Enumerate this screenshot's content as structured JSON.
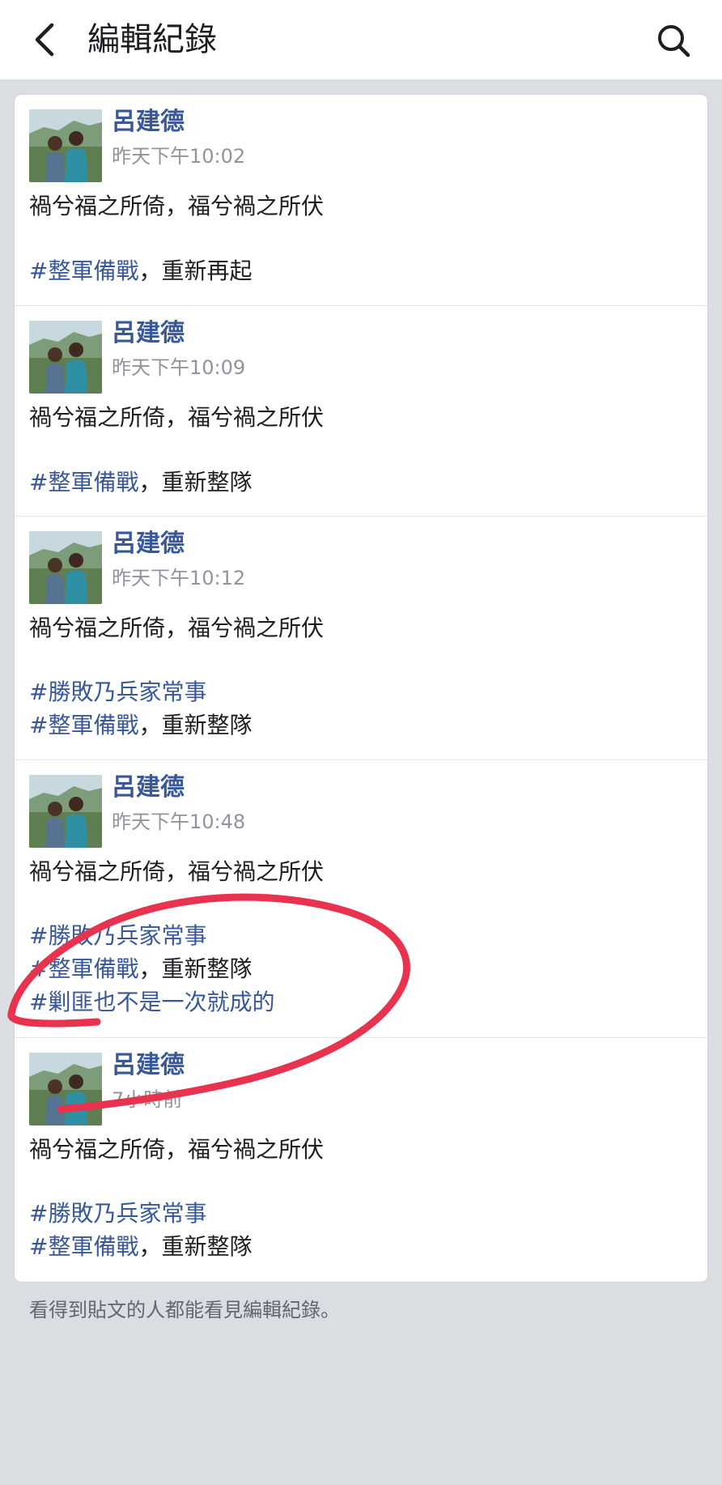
{
  "header": {
    "title": "編輯紀錄",
    "back_icon": "chevron-left-icon",
    "search_icon": "search-icon"
  },
  "entries": [
    {
      "author": "呂建德",
      "time": "昨天下午10:02",
      "line1": "禍兮福之所倚，福兮禍之所伏",
      "tags": [
        {
          "tag": "#整軍備戰",
          "rest": "，重新再起"
        }
      ]
    },
    {
      "author": "呂建德",
      "time": "昨天下午10:09",
      "line1": "禍兮福之所倚，福兮禍之所伏",
      "tags": [
        {
          "tag": "#整軍備戰",
          "rest": "，重新整隊"
        }
      ]
    },
    {
      "author": "呂建德",
      "time": "昨天下午10:12",
      "line1": "禍兮福之所倚，福兮禍之所伏",
      "tags": [
        {
          "tag": "#勝敗乃兵家常事",
          "rest": ""
        },
        {
          "tag": "#整軍備戰",
          "rest": "，重新整隊"
        }
      ]
    },
    {
      "author": "呂建德",
      "time": "昨天下午10:48",
      "line1": "禍兮福之所倚，福兮禍之所伏",
      "tags": [
        {
          "tag": "#勝敗乃兵家常事",
          "rest": ""
        },
        {
          "tag": "#整軍備戰",
          "rest": "，重新整隊"
        },
        {
          "tag": "#剿匪也不是一次就成的",
          "rest": ""
        }
      ]
    },
    {
      "author": "呂建德",
      "time": "7小時前",
      "line1": "禍兮福之所倚，福兮禍之所伏",
      "tags": [
        {
          "tag": "#勝敗乃兵家常事",
          "rest": ""
        },
        {
          "tag": "#整軍備戰",
          "rest": "，重新整隊"
        }
      ]
    }
  ],
  "footer": {
    "note": "看得到貼文的人都能看見編輯紀錄。"
  },
  "colors": {
    "hashtag": "#385898",
    "annotation": "#e8334f"
  }
}
